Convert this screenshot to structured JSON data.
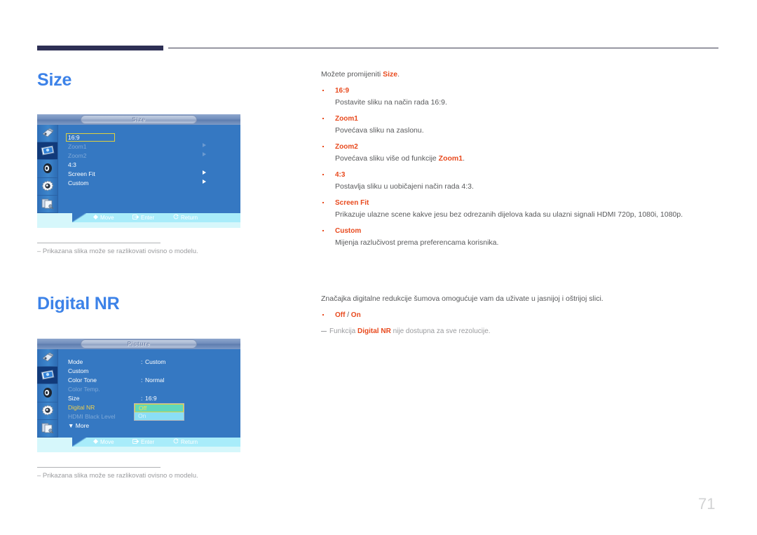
{
  "page": {
    "number": "71"
  },
  "sections": [
    {
      "heading": "Size",
      "caption": "‒  Prikazana slika može se razlikovati ovisno o modelu.",
      "osd": {
        "title": "Size",
        "footer": {
          "move": "Move",
          "enter": "Enter",
          "return": "Return"
        },
        "rows": [
          {
            "label": "16:9",
            "value": "",
            "state": "selected",
            "arrow": "none"
          },
          {
            "label": "Zoom1",
            "value": "",
            "state": "disabled",
            "arrow": "dim"
          },
          {
            "label": "Zoom2",
            "value": "",
            "state": "disabled",
            "arrow": "dim"
          },
          {
            "label": "4:3",
            "value": "",
            "state": "normal",
            "arrow": "none"
          },
          {
            "label": "Screen Fit",
            "value": "",
            "state": "normal",
            "arrow": "bright"
          },
          {
            "label": "Custom",
            "value": "",
            "state": "normal",
            "arrow": "bright"
          }
        ]
      },
      "intro_prefix": "Možete promijeniti ",
      "intro_term": "Size",
      "intro_suffix": ".",
      "items": [
        {
          "term": "16:9",
          "desc": "Postavite sliku na način rada 16:9."
        },
        {
          "term": "Zoom1",
          "desc": "Povećava sliku na zaslonu."
        },
        {
          "term": "Zoom2",
          "desc_prefix": "Povećava sliku više od funkcije ",
          "desc_term": "Zoom1",
          "desc_suffix": "."
        },
        {
          "term": "4:3",
          "desc": "Postavlja sliku u uobičajeni način rada 4:3."
        },
        {
          "term": "Screen Fit",
          "desc": "Prikazuje ulazne scene kakve jesu bez odrezanih dijelova kada su ulazni signali HDMI 720p, 1080i, 1080p."
        },
        {
          "term": "Custom",
          "desc": "Mijenja razlučivost prema preferencama korisnika."
        }
      ]
    },
    {
      "heading": "Digital NR",
      "caption": "‒  Prikazana slika može se razlikovati ovisno o modelu.",
      "osd": {
        "title": "Picture",
        "footer": {
          "move": "Move",
          "enter": "Enter",
          "return": "Return"
        },
        "rows": [
          {
            "label": "Mode",
            "sep": ":",
            "value": "Custom",
            "state": "normal"
          },
          {
            "label": "Custom",
            "sep": "",
            "value": "",
            "state": "normal"
          },
          {
            "label": "Color Tone",
            "sep": ":",
            "value": "Normal",
            "state": "normal"
          },
          {
            "label": "Color Temp.",
            "sep": "",
            "value": "",
            "state": "disabled"
          },
          {
            "label": "Size",
            "sep": ":",
            "value": "16:9",
            "state": "normal"
          },
          {
            "label": "Digital NR",
            "sep": ":",
            "value": "",
            "state": "highlight"
          },
          {
            "label": "HDMI Black Level",
            "sep": ":",
            "value": "",
            "state": "disabled"
          },
          {
            "label": "▼ More",
            "sep": "",
            "value": "",
            "state": "normal"
          }
        ],
        "dropdown": {
          "options": [
            "Off",
            "On"
          ],
          "selected": "Off"
        }
      },
      "intro": "Značajka digitalne redukcije šumova omogućuje vam da uživate u jasnijoj i oštrijoj slici.",
      "items": [
        {
          "term_off": "Off",
          "term_slash": " / ",
          "term_on": "On"
        }
      ],
      "note_prefix": "Funkcija ",
      "note_term": "Digital NR",
      "note_suffix": " nije dostupna za sve rezolucije."
    }
  ],
  "colors": {
    "heading_blue": "#3c82e8",
    "accent_orange": "#e8491d",
    "osd_blue": "#3578c2",
    "rule_navy": "#2e3055",
    "footer_cyan": "#a8ecfa",
    "highlight_yellow": "#f2d14b"
  },
  "icons": {
    "sidebar": [
      "input-plug-icon",
      "picture-monitor-icon",
      "sound-speaker-icon",
      "setup-gear-icon",
      "multicontrol-pages-icon"
    ],
    "move": "move-diamond-icon",
    "enter": "enter-button-icon",
    "return": "return-arrow-icon"
  }
}
